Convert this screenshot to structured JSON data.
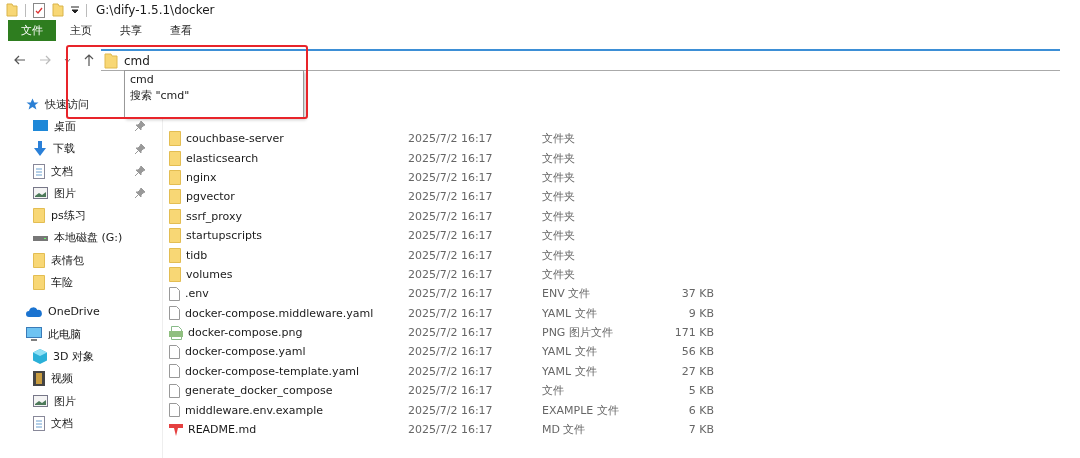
{
  "window": {
    "title": "G:\\dify-1.5.1\\docker"
  },
  "ribbon_tabs": [
    {
      "label": "文件",
      "selected": true
    },
    {
      "label": "主页",
      "selected": false
    },
    {
      "label": "共享",
      "selected": false
    },
    {
      "label": "查看",
      "selected": false
    }
  ],
  "address_bar": {
    "value": "cmd",
    "suggestions": [
      "cmd",
      "搜索 \"cmd\""
    ]
  },
  "sidebar": {
    "items": [
      {
        "label": "快速访问",
        "kind": "star",
        "children": [
          {
            "label": "桌面",
            "kind": "desktop",
            "pinned": true
          },
          {
            "label": "下载",
            "kind": "download",
            "pinned": true
          },
          {
            "label": "文档",
            "kind": "document",
            "pinned": true
          },
          {
            "label": "图片",
            "kind": "pictures",
            "pinned": true
          },
          {
            "label": "ps练习",
            "kind": "folder",
            "pinned": false
          },
          {
            "label": "本地磁盘 (G:)",
            "kind": "drive",
            "pinned": false
          },
          {
            "label": "表情包",
            "kind": "folder",
            "pinned": false
          },
          {
            "label": "车险",
            "kind": "folder",
            "pinned": false
          }
        ]
      },
      {
        "label": "OneDrive",
        "kind": "cloud"
      },
      {
        "label": "此电脑",
        "kind": "computer",
        "children": [
          {
            "label": "3D 对象",
            "kind": "cube",
            "pinned": false
          },
          {
            "label": "视频",
            "kind": "video",
            "pinned": false
          },
          {
            "label": "图片",
            "kind": "pictures",
            "pinned": false
          },
          {
            "label": "文档",
            "kind": "document",
            "pinned": false
          }
        ]
      }
    ]
  },
  "files": [
    {
      "name": "couchbase-server",
      "date": "2025/7/2 16:17",
      "type": "文件夹",
      "kind": "folder"
    },
    {
      "name": "elasticsearch",
      "date": "2025/7/2 16:17",
      "type": "文件夹",
      "kind": "folder"
    },
    {
      "name": "nginx",
      "date": "2025/7/2 16:17",
      "type": "文件夹",
      "kind": "folder"
    },
    {
      "name": "pgvector",
      "date": "2025/7/2 16:17",
      "type": "文件夹",
      "kind": "folder"
    },
    {
      "name": "ssrf_proxy",
      "date": "2025/7/2 16:17",
      "type": "文件夹",
      "kind": "folder"
    },
    {
      "name": "startupscripts",
      "date": "2025/7/2 16:17",
      "type": "文件夹",
      "kind": "folder"
    },
    {
      "name": "tidb",
      "date": "2025/7/2 16:17",
      "type": "文件夹",
      "kind": "folder"
    },
    {
      "name": "volumes",
      "date": "2025/7/2 16:17",
      "type": "文件夹",
      "kind": "folder"
    },
    {
      "name": ".env",
      "date": "2025/7/2 16:17",
      "type": "ENV 文件",
      "size": "37 KB",
      "kind": "file"
    },
    {
      "name": "docker-compose.middleware.yaml",
      "date": "2025/7/2 16:17",
      "type": "YAML 文件",
      "size": "9 KB",
      "kind": "file"
    },
    {
      "name": "docker-compose.png",
      "date": "2025/7/2 16:17",
      "type": "PNG 图片文件",
      "size": "171 KB",
      "kind": "image"
    },
    {
      "name": "docker-compose.yaml",
      "date": "2025/7/2 16:17",
      "type": "YAML 文件",
      "size": "56 KB",
      "kind": "file"
    },
    {
      "name": "docker-compose-template.yaml",
      "date": "2025/7/2 16:17",
      "type": "YAML 文件",
      "size": "27 KB",
      "kind": "file"
    },
    {
      "name": "generate_docker_compose",
      "date": "2025/7/2 16:17",
      "type": "文件",
      "size": "5 KB",
      "kind": "file"
    },
    {
      "name": "middleware.env.example",
      "date": "2025/7/2 16:17",
      "type": "EXAMPLE 文件",
      "size": "6 KB",
      "kind": "file"
    },
    {
      "name": "README.md",
      "date": "2025/7/2 16:17",
      "type": "MD 文件",
      "size": "7 KB",
      "kind": "markdown"
    }
  ]
}
